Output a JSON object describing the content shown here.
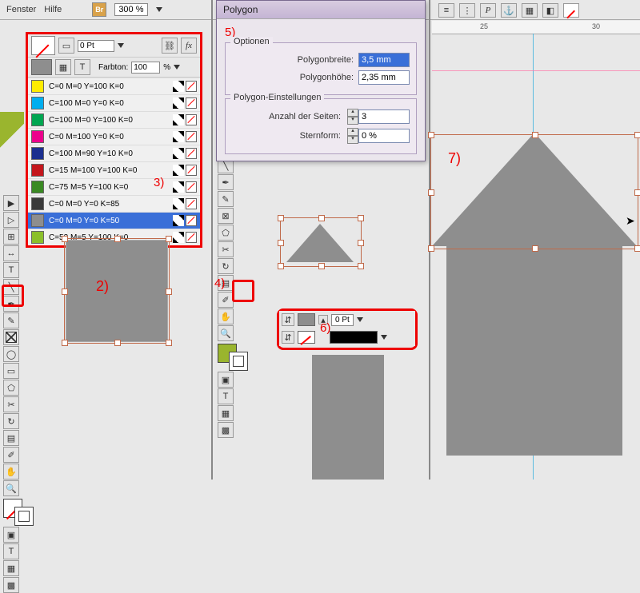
{
  "menus": {
    "fenster": "Fenster",
    "hilfe": "Hilfe"
  },
  "topbar": {
    "br": "Br",
    "zoom": "300 %"
  },
  "swatches": {
    "pt": "0 Pt",
    "farbton_label": "Farbton:",
    "farbton_value": "100",
    "farbton_unit": "%",
    "items": [
      {
        "name": "C=0 M=0 Y=100 K=0",
        "hex": "#ffec00"
      },
      {
        "name": "C=100 M=0 Y=0 K=0",
        "hex": "#00aeef"
      },
      {
        "name": "C=100 M=0 Y=100 K=0",
        "hex": "#00a651"
      },
      {
        "name": "C=0 M=100 Y=0 K=0",
        "hex": "#ec008c"
      },
      {
        "name": "C=100 M=90 Y=10 K=0",
        "hex": "#1b2f8f"
      },
      {
        "name": "C=15 M=100 Y=100 K=0",
        "hex": "#c4161c"
      },
      {
        "name": "C=75 M=5 Y=100 K=0",
        "hex": "#3a8a23"
      },
      {
        "name": "C=0 M=0 Y=0 K=85",
        "hex": "#3a3a3a"
      },
      {
        "name": "C=0 M=0 Y=0 K=50",
        "hex": "#8e8e8e"
      },
      {
        "name": "C=53 M=5 Y=100 K=0",
        "hex": "#8bbf2a"
      }
    ],
    "selected_index": 8
  },
  "dialog": {
    "title": "Polygon",
    "opt_heading": "Optionen",
    "width_label": "Polygonbreite:",
    "width_value": "3,5 mm",
    "height_label": "Polygonhöhe:",
    "height_value": "2,35 mm",
    "settings_heading": "Polygon-Einstellungen",
    "sides_label": "Anzahl der Seiten:",
    "sides_value": "3",
    "star_label": "Sternform:",
    "star_value": "0 %"
  },
  "stroke_mini": {
    "pt": "0 Pt"
  },
  "ruler": {
    "t25": "25",
    "t30": "30"
  },
  "labels": {
    "l2": "2)",
    "l3": "3)",
    "l4": "4)",
    "l5": "5)",
    "l6": "6)",
    "l7": "7)"
  },
  "chart_data": null
}
